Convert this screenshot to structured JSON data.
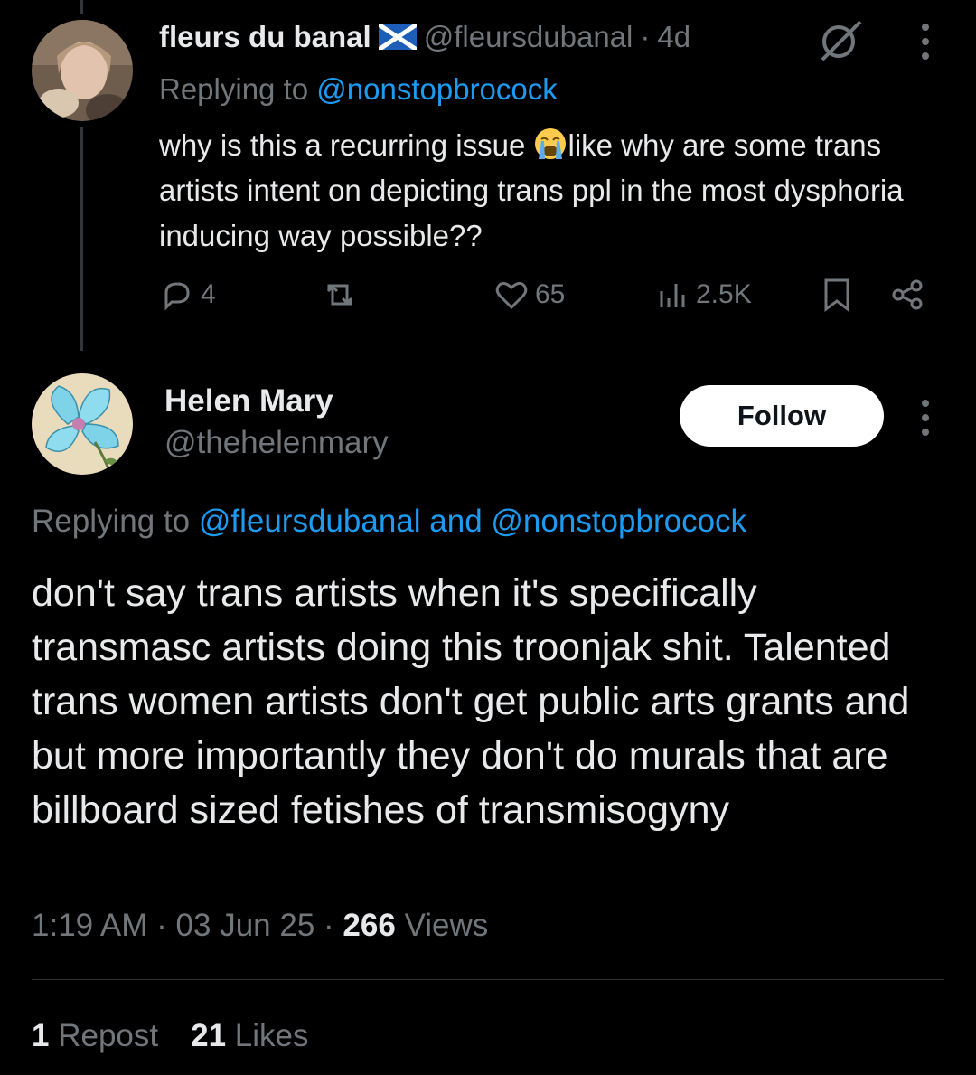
{
  "parent_tweet": {
    "display_name": "fleurs du banal",
    "handle": "@fleursdubanal",
    "separator": "·",
    "time": "4d",
    "replying_prefix": "Replying to",
    "replying_to": "@nonstopbrocock",
    "text_before_emoji": "why is this a recurring issue ",
    "emoji": "loudly-crying-face",
    "text_after_emoji": "like why are some trans artists intent on depicting trans ppl in the most dysphoria inducing way possible??",
    "replies": "4",
    "likes": "65",
    "views": "2.5K"
  },
  "main_tweet": {
    "display_name": "Helen Mary",
    "handle": "@thehelenmary",
    "follow_label": "Follow",
    "replying_prefix": "Replying to",
    "replying_to_1": "@fleursdubanal",
    "replying_and": "and",
    "replying_to_2": "@nonstopbrocock",
    "text": "don't say trans artists when it's specifically transmasc artists doing this troonjak shit. Talented trans women artists don't get public arts grants and but more importantly they don't do murals that are billboard sized fetishes of transmisogyny",
    "time": "1:19 AM",
    "separator": "·",
    "date": "03 Jun 25",
    "views_count": "266",
    "views_label": "Views",
    "reposts_count": "1",
    "reposts_label": "Repost",
    "likes_count": "21",
    "likes_label": "Likes"
  },
  "colors": {
    "background": "#000000",
    "text": "#e7e9ea",
    "secondary": "#71767b",
    "link": "#1d9bf0"
  }
}
